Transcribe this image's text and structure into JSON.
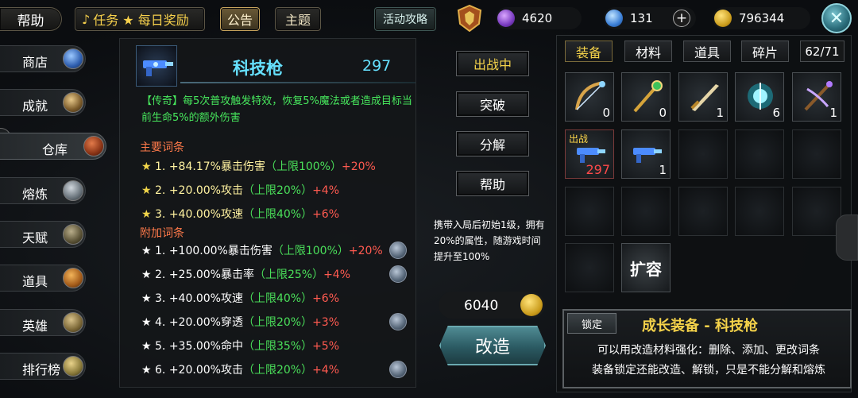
{
  "topbar": {
    "help": "帮助",
    "task": "任务 ★ 每日奖励",
    "notice": "公告",
    "theme": "主题",
    "guide": "活动攻略",
    "gem": "4620",
    "diamond": "131",
    "gold": "796344"
  },
  "nav": [
    {
      "label": "商店"
    },
    {
      "label": "成就"
    },
    {
      "label": "仓库"
    },
    {
      "label": "熔炼"
    },
    {
      "label": "天赋"
    },
    {
      "label": "道具"
    },
    {
      "label": "英雄"
    },
    {
      "label": "排行榜"
    }
  ],
  "item": {
    "name": "科技枪",
    "power": "297",
    "legend": "【传奇】每5次普攻触发特效，恢复5%魔法或者造成目标当前生命5%的额外伤害",
    "main_title": "主要词条",
    "main_affixes": [
      {
        "star": "★",
        "num": "1.",
        "text": "+84.17%暴击伤害",
        "cap": "（上限100%）",
        "up": "+20%"
      },
      {
        "star": "★",
        "num": "2.",
        "text": "+20.00%攻击",
        "cap": "（上限20%）",
        "up": "+4%"
      },
      {
        "star": "★",
        "num": "3.",
        "text": "+40.00%攻速",
        "cap": "（上限40%）",
        "up": "+6%"
      }
    ],
    "extra_title": "附加词条",
    "extra_affixes": [
      {
        "star": "★",
        "num": "1.",
        "text": "+100.00%暴击伤害",
        "cap": "（上限100%）",
        "up": "+20%"
      },
      {
        "star": "★",
        "num": "2.",
        "text": "+25.00%暴击率",
        "cap": "（上限25%）",
        "up": "+4%"
      },
      {
        "star": "★",
        "num": "3.",
        "text": "+40.00%攻速",
        "cap": "（上限40%）",
        "up": "+6%"
      },
      {
        "star": "★",
        "num": "4.",
        "text": "+20.00%穿透",
        "cap": "（上限20%）",
        "up": "+3%"
      },
      {
        "star": "★",
        "num": "5.",
        "text": "+35.00%命中",
        "cap": "（上限35%）",
        "up": "+5%"
      },
      {
        "star": "★",
        "num": "6.",
        "text": "+20.00%攻击",
        "cap": "（上限20%）",
        "up": "+4%"
      }
    ]
  },
  "actions": {
    "deployed": "出战中",
    "breakthrough": "突破",
    "dismantle": "分解",
    "help": "帮助",
    "carry_note": "携带入局后初始1级，拥有20%的属性，随游戏时间提升至100%",
    "cost": "6040",
    "reforge": "改造"
  },
  "inventory": {
    "tabs": [
      "装备",
      "材料",
      "道具",
      "碎片"
    ],
    "count": "62/71",
    "slots": [
      {
        "icon": "bow-icon",
        "qty": "0",
        "tag": ""
      },
      {
        "icon": "staff-icon",
        "qty": "0",
        "tag": ""
      },
      {
        "icon": "sword-icon",
        "qty": "1",
        "tag": ""
      },
      {
        "icon": "orb-icon",
        "qty": "6",
        "tag": ""
      },
      {
        "icon": "crossbow-icon",
        "qty": "1",
        "tag": ""
      },
      {
        "icon": "tech-gun-icon",
        "qty": "297",
        "tag": "出战"
      },
      {
        "icon": "tech-gun-icon",
        "qty": "1",
        "tag": ""
      }
    ],
    "expand": "扩容"
  },
  "info": {
    "lock": "锁定",
    "title": "成长装备 - 科技枪",
    "line1": "可以用改造材料强化：删除、添加、更改词条",
    "line2": "装备锁定还能改造、解锁，只是不能分解和熔炼"
  },
  "colors": {
    "accent": "#66e1ff",
    "legend_green": "#47e85d",
    "up_red": "#ff5a50",
    "gold": "#f4d24a"
  }
}
